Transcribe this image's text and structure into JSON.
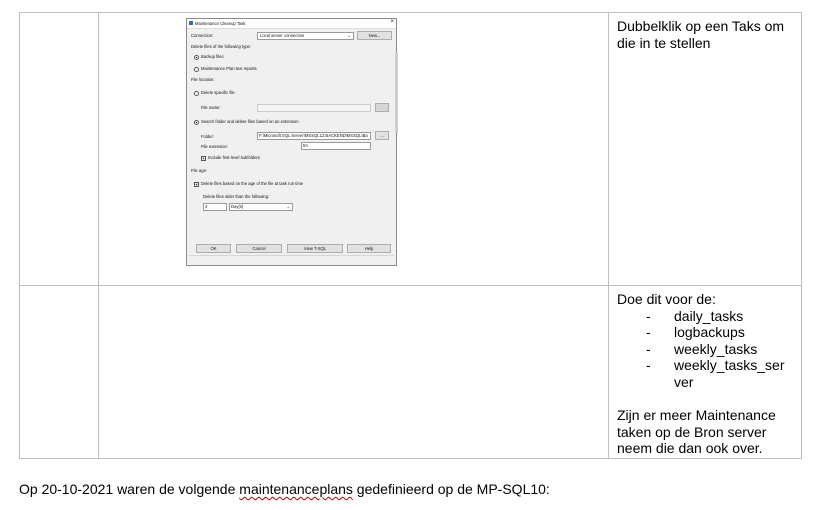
{
  "table": {
    "row1": {
      "right_text": "Dubbelklik op een Taks om die in te stellen"
    },
    "row2": {
      "intro": "Doe dit voor de:",
      "tasks": [
        "daily_tasks",
        "logbackups",
        "weekly_tasks",
        "weekly_tasks_server"
      ],
      "dash": "-",
      "note": "Zijn er meer Maintenance taken op de Bron server neem die dan ook over."
    }
  },
  "dialog": {
    "title": "Maintenance Cleanup Task",
    "close": "×",
    "connection_label": "Connection:",
    "connection_value": "Local server connection",
    "new_button": "New...",
    "delete_files_label": "Delete files of the following type:",
    "opt_backup": "Backup files",
    "opt_reports": "Maintenance Plan text reports",
    "file_location_label": "File location:",
    "opt_delete_specific": "Delete specific file",
    "file_name_label": "File name:",
    "opt_search_folder": "Search folder and delete files based on an extension",
    "folder_label": "Folder:",
    "folder_value": "F:\\Microsoft SQL Server\\MSSQL12.BACKEND\\MSSQL\\Ba",
    "browse_button": "...",
    "file_extension_label": "File extension:",
    "file_extension_value": "trn",
    "include_subfolders": "Include first-level subfolders",
    "file_age_label": "File age:",
    "delete_by_age": "Delete files based on the age of the file at task run time",
    "older_than_label": "Delete files older than the following:",
    "age_number": "4",
    "age_unit": "Day(s)",
    "ok_button": "OK",
    "cancel_button": "Cancel",
    "tsql_button": "View T-SQL",
    "help_button": "Help"
  },
  "footer": {
    "before": "Op 20-10-2021 waren de volgende ",
    "misspelled": "maintenanceplans",
    "after": " gedefinieerd op de MP-SQL10:"
  }
}
